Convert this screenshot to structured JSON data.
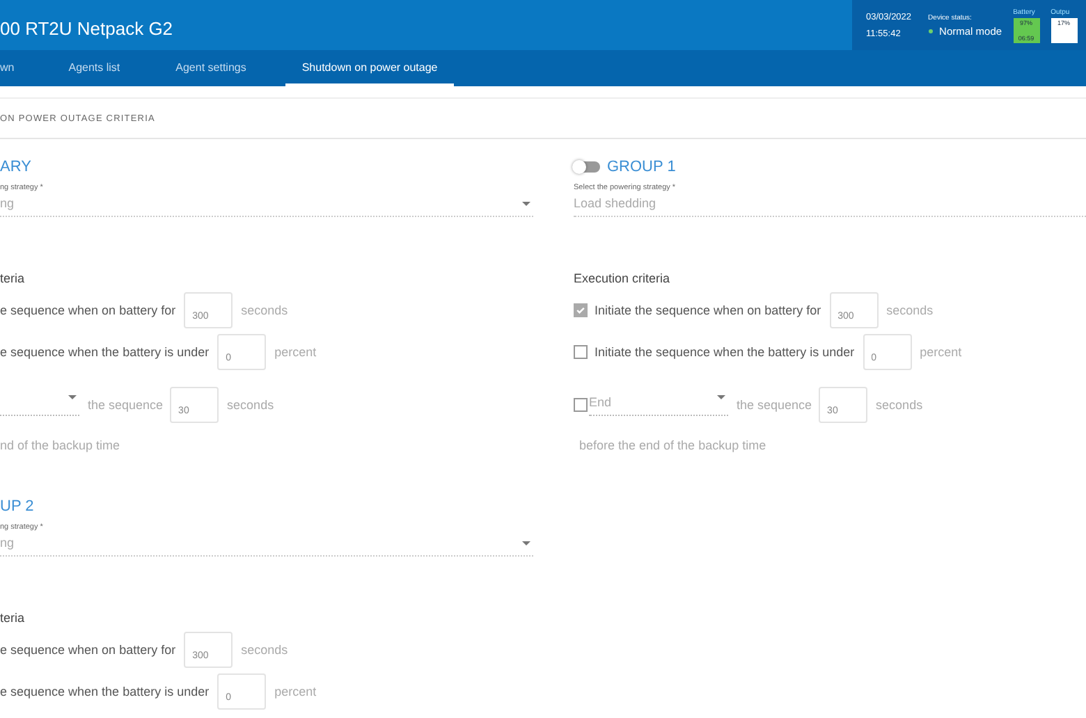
{
  "header": {
    "title": "00 RT2U Netpack G2",
    "date": "03/03/2022",
    "time": "11:55:42",
    "status_label": "Device status:",
    "status": "Normal mode",
    "battery": {
      "label": "Battery",
      "percent": "97%",
      "runtime": "06:59"
    },
    "output": {
      "label": "Outpu",
      "percent": "17%"
    }
  },
  "tabs": [
    {
      "label": "wn",
      "selected": false
    },
    {
      "label": "Agents list",
      "selected": false
    },
    {
      "label": "Agent settings",
      "selected": false
    },
    {
      "label": "Shutdown on power outage",
      "selected": true
    }
  ],
  "section_title": "ON POWER OUTAGE CRITERIA",
  "columns": [
    [
      {
        "title": "ARY",
        "strategy_label": "ng strategy *",
        "strategy": "ng",
        "criteria_title": "teria",
        "criteria": [
          {
            "kind": "input",
            "text": "e sequence when on battery for",
            "value": "300",
            "unit": "seconds"
          },
          {
            "kind": "input",
            "text": "e sequence when the battery is under",
            "value": "0",
            "unit": "percent"
          },
          {
            "kind": "select",
            "text": "the sequence",
            "value": "30",
            "unit": "seconds"
          }
        ],
        "note": "nd of the backup time"
      },
      {
        "title": "UP 2",
        "strategy_label": "ng strategy *",
        "strategy": "ng",
        "criteria_title": "teria",
        "criteria": [
          {
            "kind": "input",
            "text": "e sequence when on battery for",
            "value": "300",
            "unit": "seconds"
          },
          {
            "kind": "input",
            "text": "e sequence when the battery is under",
            "value": "0",
            "unit": "percent"
          }
        ]
      }
    ],
    [
      {
        "title": "GROUP 1",
        "toggle_on": false,
        "strategy_label": "Select the powering strategy *",
        "strategy": "Load shedding",
        "criteria_title": "Execution criteria",
        "criteria": [
          {
            "kind": "input",
            "checked": true,
            "text": "Initiate the sequence when on battery for",
            "value": "300",
            "unit": "seconds"
          },
          {
            "kind": "input",
            "checked": false,
            "text": "Initiate the sequence when the battery is under",
            "value": "0",
            "unit": "percent"
          },
          {
            "kind": "select",
            "checked": false,
            "select_value": "End",
            "text": "the sequence",
            "value": "30",
            "unit": "seconds"
          }
        ],
        "note": "before the end of the backup time"
      }
    ]
  ]
}
